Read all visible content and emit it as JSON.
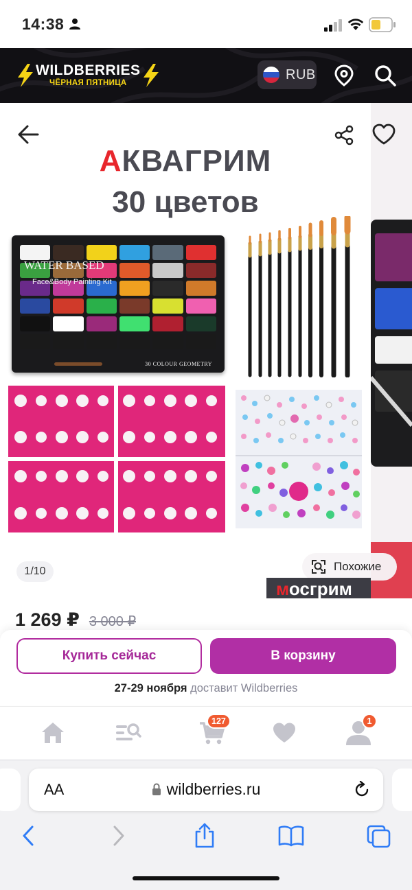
{
  "status_bar": {
    "time": "14:38",
    "icons": [
      "person-icon",
      "signal-icon",
      "wifi-icon",
      "battery-icon"
    ]
  },
  "header": {
    "brand_name": "WILDBERRIES",
    "brand_subtitle": "ЧЁРНАЯ ПЯТНИЦА",
    "currency": "RUB",
    "icons": [
      "russia-flag-icon",
      "location-pin-icon",
      "search-icon"
    ],
    "colors": {
      "background": "#111014",
      "accent": "#f5d416"
    }
  },
  "gallery": {
    "title_accent_letter": "А",
    "title_rest": "КВАГРИМ",
    "subtitle": "30 цветов",
    "palette_text_main": "WATER BASED",
    "palette_text_sub": "Face&Body Painting Kit",
    "palette_text_bottom": "30 COLOUR GEOMETRY",
    "counter": "1/10",
    "similar_label": "Похожие",
    "next_slide_brand_accent": "м",
    "next_slide_brand_rest": "осгрим",
    "icons": [
      "back-arrow-icon",
      "share-icon",
      "heart-icon",
      "similar-search-icon"
    ]
  },
  "product": {
    "price": "1 269 ₽",
    "old_price": "3 000 ₽"
  },
  "buy_panel": {
    "buy_now_label": "Купить сейчас",
    "add_to_cart_label": "В корзину",
    "delivery_dates": "27-29 ноября",
    "delivery_by": "доставит Wildberries",
    "colors": {
      "primary": "#b12fa5"
    }
  },
  "tabbar": {
    "items": [
      {
        "icon": "home-icon"
      },
      {
        "icon": "catalog-search-icon"
      },
      {
        "icon": "cart-icon",
        "badge": "127"
      },
      {
        "icon": "favorites-heart-icon"
      },
      {
        "icon": "profile-icon",
        "badge": "1"
      }
    ],
    "badge_color": "#f05a30"
  },
  "browser": {
    "aa_label": "AA",
    "url": "wildberries.ru",
    "icons": [
      "lock-icon",
      "reload-icon",
      "back-chevron-icon",
      "forward-chevron-icon",
      "share-icon",
      "bookmarks-icon",
      "tabs-icon"
    ]
  }
}
